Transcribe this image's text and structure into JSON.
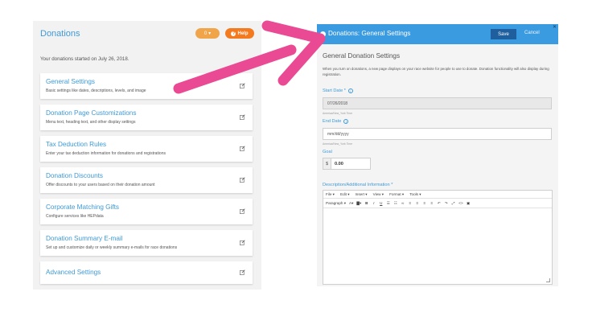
{
  "left": {
    "title": "Donations",
    "badge": "0",
    "help_label": "Help",
    "intro": "Your donations started on July 26, 2018.",
    "cards": [
      {
        "title": "General Settings",
        "desc": "Basic settings like dates, descriptions, levels, and image"
      },
      {
        "title": "Donation Page Customizations",
        "desc": "Menu text, heading text, and other display settings"
      },
      {
        "title": "Tax Deduction Rules",
        "desc": "Enter your tax deduction information for donations and registrations"
      },
      {
        "title": "Donation Discounts",
        "desc": "Offer discounts to your users based on their donation amount"
      },
      {
        "title": "Corporate Matching Gifts",
        "desc": "Configure services like HEPdata"
      },
      {
        "title": "Donation Summary E-mail",
        "desc": "Set up and customize daily or weekly summary e-mails for race donations"
      },
      {
        "title": "Advanced Settings",
        "desc": ""
      }
    ]
  },
  "right": {
    "header_title": "Donations: General Settings",
    "save_label": "Save",
    "cancel_label": "Cancel",
    "close_glyph": "✕",
    "section_title": "General Donation Settings",
    "description": "When you turn on donations, a new page displays on your race website for people to use to donate. Donation functionality will also display during registration.",
    "start_date_label": "Start Date *",
    "start_date_value": "07/26/2018",
    "start_tz": "America/New_York Time",
    "end_date_label": "End Date",
    "end_date_placeholder": "mm/dd/yyyy",
    "end_tz": "America/New_York Time",
    "goal_label": "Goal",
    "goal_symbol": "$",
    "goal_value": "0.00",
    "desc_label": "Description/Additional Information *",
    "editor_menu": [
      "File",
      "Edit",
      "Insert",
      "View",
      "Format",
      "Tools"
    ],
    "editor_format": "Paragraph"
  },
  "colors": {
    "accent": "#3e9ad6",
    "header": "#3b9be0",
    "save": "#1f5f9e",
    "arrow": "#ea4a93",
    "help": "#f47a20"
  }
}
